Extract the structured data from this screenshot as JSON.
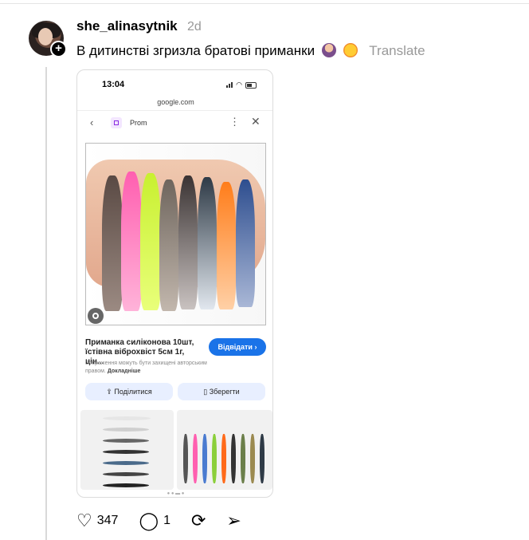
{
  "post": {
    "username": "she_alinasytnik",
    "time": "2d",
    "text": "В дитинстві згризла братові приманки",
    "translate_label": "Translate"
  },
  "screenshot": {
    "status_time": "13:04",
    "url": "google.com",
    "site_name": "Prom",
    "product_title": "Приманка силіконова 10шт, їстівна віброхвіст 5см 1г, цін...",
    "visit_label": "Відвідати",
    "copyright_text": "Зображення можуть бути захищені авторським правом.",
    "learn_more": "Докладніше",
    "share_label": "Поділитися",
    "save_label": "Зберегти"
  },
  "actions": {
    "likes": "347",
    "replies": "1"
  },
  "icons": [
    "plus-icon",
    "back-icon",
    "more-icon",
    "close-icon",
    "lens-icon",
    "share-icon",
    "bookmark-icon",
    "heart-icon",
    "comment-icon",
    "repost-icon",
    "send-icon"
  ],
  "colors": {
    "accent": "#1a73e8",
    "muted": "#999999"
  }
}
